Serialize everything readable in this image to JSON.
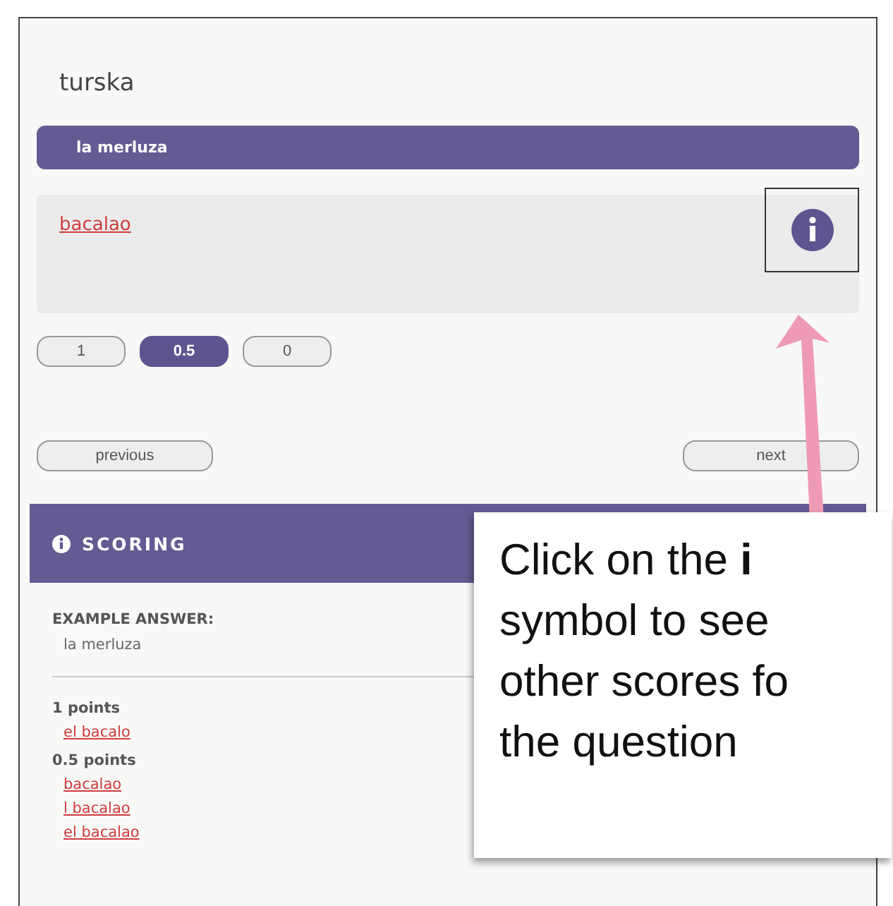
{
  "question": {
    "prompt": "turska",
    "answer": "la merluza",
    "response": "bacalao"
  },
  "scores": [
    {
      "label": "1",
      "selected": false
    },
    {
      "label": "0.5",
      "selected": true
    },
    {
      "label": "0",
      "selected": false
    }
  ],
  "nav": {
    "previous": "previous",
    "next": "next"
  },
  "scoring": {
    "title": "SCORING",
    "example_label": "EXAMPLE ANSWER:",
    "example": "la merluza",
    "groups": [
      {
        "label": "1 points",
        "answers": [
          "el bacalo"
        ]
      },
      {
        "label": "0.5 points",
        "answers": [
          "bacalao",
          "l bacalao",
          "el bacalao"
        ]
      }
    ]
  },
  "callout": {
    "text": "Click on the **i** symbol to see other scores fo the question"
  }
}
